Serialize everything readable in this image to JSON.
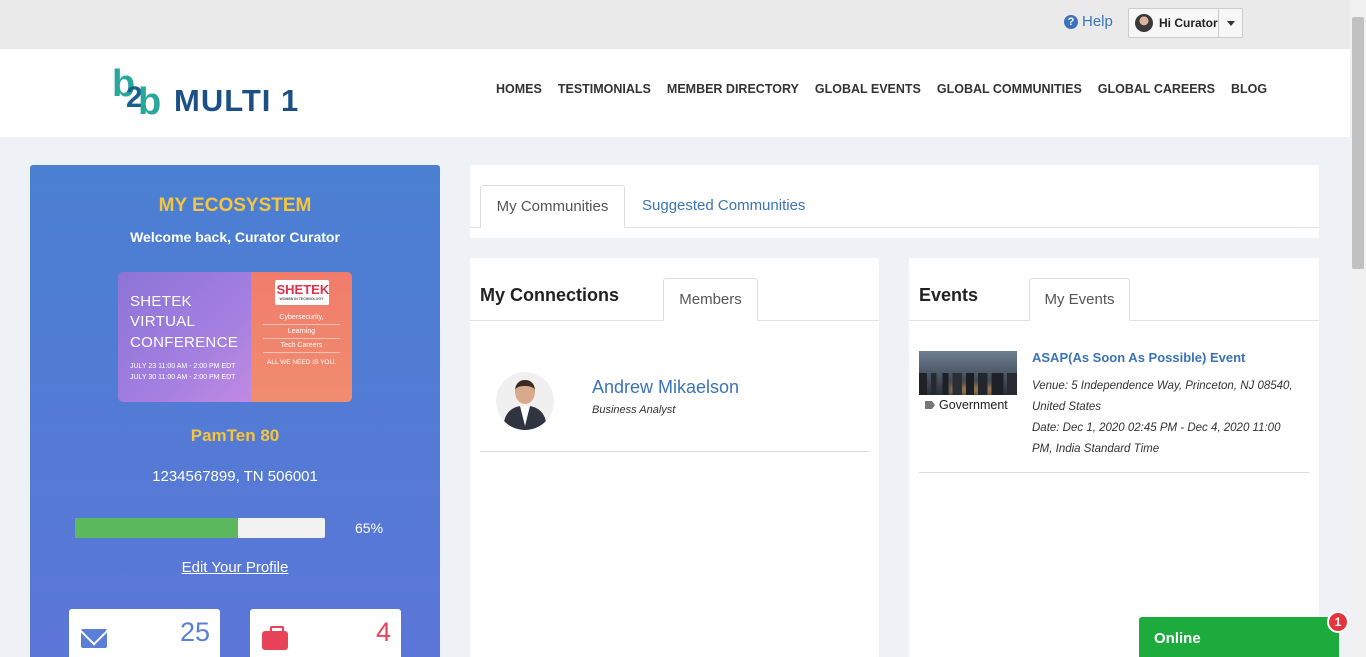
{
  "topbar": {
    "help_label": "Help",
    "user_label": "Hi Curator"
  },
  "header": {
    "logo_text": "MULTI 1",
    "nav": [
      "HOMES",
      "TESTIMONIALS",
      "MEMBER DIRECTORY",
      "GLOBAL EVENTS",
      "GLOBAL COMMUNITIES",
      "GLOBAL CAREERS",
      "BLOG"
    ]
  },
  "ecosystem": {
    "title": "MY ECOSYSTEM",
    "welcome": "Welcome back, Curator Curator",
    "banner": {
      "title": "SHETEK VIRTUAL CONFERENCE",
      "date1": "JULY 23 11:00 AM - 2:00 PM EDT",
      "date2": "JULY 30 11:00 AM - 2:00 PM EDT",
      "brand": "SHETEK",
      "brand_sub": "WOMEN IN TECHNOLOGY",
      "topic1": "Cybersecurity,",
      "topic2": "Learning",
      "topic3": "Tech Careers",
      "tagline": "ALL WE NEED IS YOU."
    },
    "company": "PamTen 80",
    "phone_location": "1234567899, TN 506001",
    "profile_completion": 0.65,
    "profile_completion_label": "65%",
    "edit_profile_label": "Edit Your Profile",
    "messages_count": "25",
    "jobs_count": "4"
  },
  "communities": {
    "tabs": [
      "My Communities",
      "Suggested Communities"
    ],
    "active_tab": "My Communities"
  },
  "connections": {
    "title": "My Connections",
    "tab": "Members",
    "items": [
      {
        "name": "Andrew Mikaelson",
        "role": "Business Analyst"
      }
    ]
  },
  "events": {
    "title": "Events",
    "tab": "My Events",
    "items": [
      {
        "title": "ASAP(As Soon As Possible) Event",
        "venue": "Venue: 5 Independence Way, Princeton, NJ 08540, United States",
        "date": "Date: Dec 1, 2020 02:45 PM - Dec 4, 2020 11:00 PM, India Standard Time",
        "tag": "Government"
      }
    ]
  },
  "chat": {
    "label": "Online",
    "badge": "1"
  },
  "colors": {
    "accent_blue": "#3b73b9",
    "gold": "#f5c53d",
    "progress_green": "#5cb85c",
    "chat_green": "#1eab3e",
    "badge_red": "#e5343d"
  }
}
